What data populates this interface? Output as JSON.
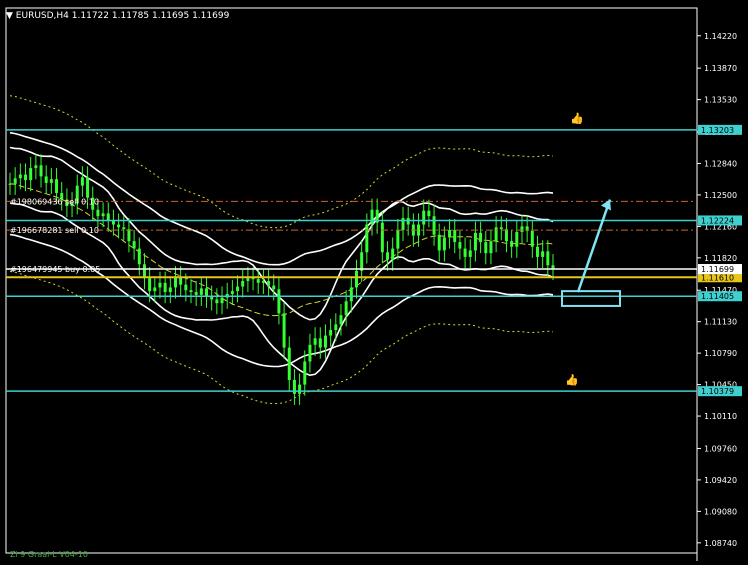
{
  "header": {
    "symbol": "EURUSD,H4",
    "open": "1.11722",
    "high": "1.11785",
    "low": "1.11695",
    "close": "1.11699"
  },
  "footer": {
    "indicator": "Zi 9 Graal-L V04-10"
  },
  "colors": {
    "background": "#000000",
    "candle": "#33ff33",
    "level_line": "#3fcfcf",
    "band": "#ffffff",
    "band_dotted": "#d6d62a",
    "order_line": "#c8662a",
    "buy_line": "#e6c619",
    "arrow": "#7fe3f4"
  },
  "chart_data": {
    "type": "candlestick",
    "title": "EURUSD,H4",
    "ylim": [
      1.0863,
      1.1452
    ],
    "y_ticks": [
      "1.14220",
      "1.13870",
      "1.13530",
      "1.13180",
      "1.12840",
      "1.12500",
      "1.12160",
      "1.11820",
      "1.11470",
      "1.11130",
      "1.10790",
      "1.10450",
      "1.10110",
      "1.09760",
      "1.09420",
      "1.09080",
      "1.08740"
    ],
    "horizontal_levels": [
      {
        "price": 1.13203,
        "label": "1.13203",
        "style": "solid",
        "color": "#3fcfcf"
      },
      {
        "price": 1.12224,
        "label": "1.12224",
        "style": "solid",
        "color": "#3fcfcf"
      },
      {
        "price": 1.11405,
        "label": "1.11405",
        "style": "solid",
        "color": "#3fcfcf"
      },
      {
        "price": 1.10379,
        "label": "1.10379",
        "style": "solid",
        "color": "#3fcfcf"
      },
      {
        "price": 1.1161,
        "label": "1.11610",
        "style": "solid",
        "color": "#e6c619"
      },
      {
        "price": 1.11699,
        "label": "1.11699",
        "style": "solid",
        "color": "#ffffff"
      }
    ],
    "orders": [
      {
        "label": "#198069436 sell 0.10",
        "price": 1.1243
      },
      {
        "label": "#196678281 sell 0.10",
        "price": 1.1212
      },
      {
        "label": "#196479945 buy 0.05",
        "price": 1.117
      }
    ],
    "order_dashed_levels": [
      1.1243,
      1.1212
    ],
    "close_series": [
      1.1262,
      1.1268,
      1.1272,
      1.1266,
      1.1279,
      1.1282,
      1.127,
      1.1263,
      1.1267,
      1.1252,
      1.1245,
      1.1238,
      1.1241,
      1.126,
      1.1269,
      1.1247,
      1.1234,
      1.1227,
      1.123,
      1.1222,
      1.1218,
      1.1215,
      1.1213,
      1.12,
      1.1192,
      1.1175,
      1.116,
      1.1146,
      1.115,
      1.1155,
      1.1145,
      1.115,
      1.1161,
      1.1153,
      1.1147,
      1.1145,
      1.1142,
      1.1149,
      1.114,
      1.1137,
      1.1133,
      1.1139,
      1.1143,
      1.1146,
      1.1151,
      1.1157,
      1.116,
      1.1159,
      1.1155,
      1.1157,
      1.1152,
      1.1148,
      1.1122,
      1.1085,
      1.105,
      1.1035,
      1.1045,
      1.107,
      1.1088,
      1.1095,
      1.1085,
      1.1098,
      1.1104,
      1.111,
      1.112,
      1.1135,
      1.115,
      1.1168,
      1.1188,
      1.1218,
      1.1234,
      1.122,
      1.1188,
      1.118,
      1.1192,
      1.1212,
      1.1225,
      1.1218,
      1.1206,
      1.1218,
      1.1233,
      1.1227,
      1.1207,
      1.119,
      1.1204,
      1.1212,
      1.1199,
      1.1192,
      1.1183,
      1.119,
      1.1209,
      1.1199,
      1.1187,
      1.12,
      1.1215,
      1.1213,
      1.12,
      1.1194,
      1.121,
      1.1216,
      1.1211,
      1.1194,
      1.1183,
      1.1189,
      1.1174,
      1.117
    ]
  }
}
